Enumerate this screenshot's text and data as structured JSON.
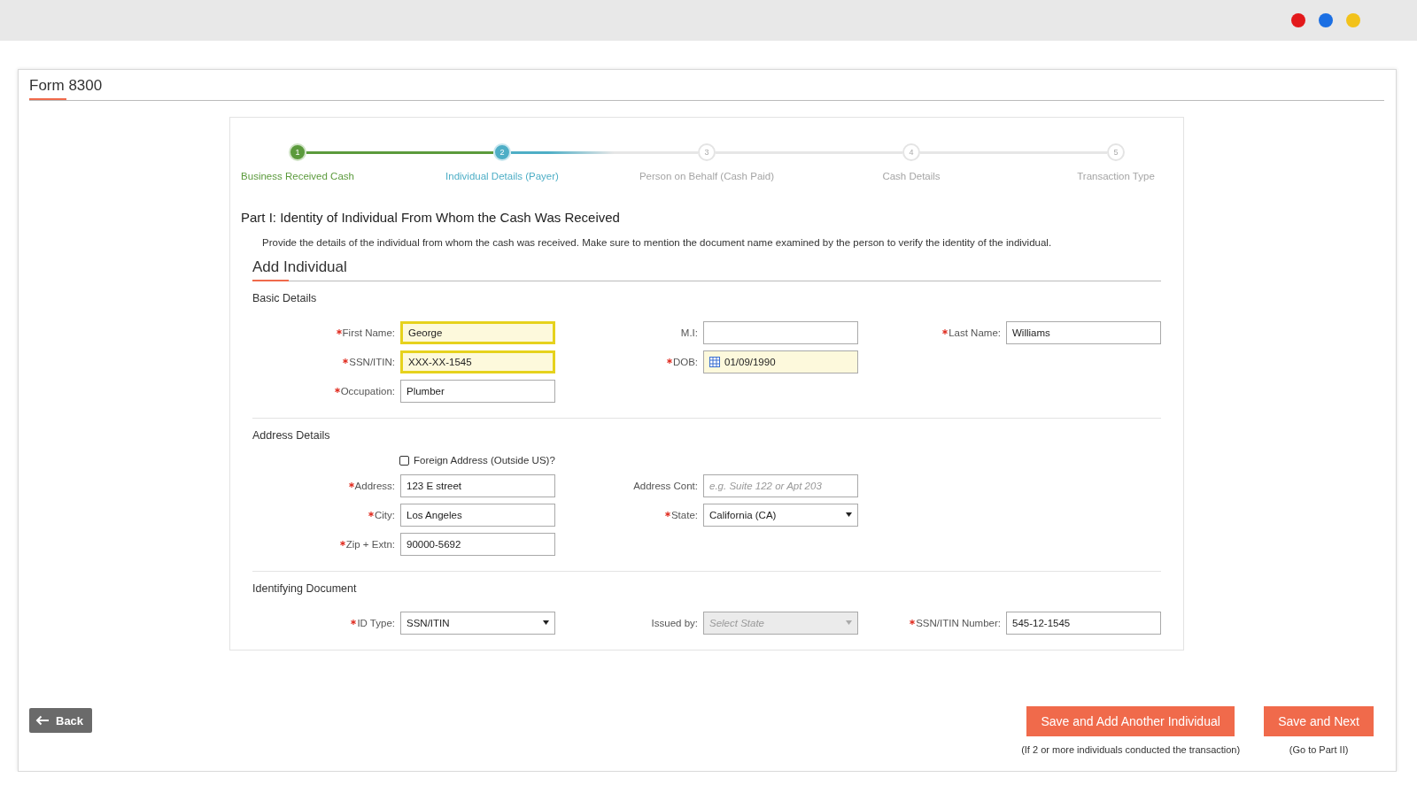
{
  "window_dots": [
    {
      "color": "#e3191b"
    },
    {
      "color": "#1b6fe3"
    },
    {
      "color": "#f2c21b"
    }
  ],
  "title": "Form 8300",
  "steps": [
    {
      "number": "1",
      "label": "Business Received Cash",
      "kind": "done"
    },
    {
      "number": "2",
      "label": "Individual Details (Payer)",
      "kind": "current"
    },
    {
      "number": "3",
      "label": "Person on Behalf (Cash Paid)",
      "kind": "pending"
    },
    {
      "number": "4",
      "label": "Cash Details",
      "kind": "pending"
    },
    {
      "number": "5",
      "label": "Transaction Type",
      "kind": "pending"
    }
  ],
  "part": {
    "heading": "Part I: Identity of Individual From Whom the Cash Was Received",
    "description": "Provide the details of the individual from whom the cash was received. Make sure to mention the document name examined by the person to verify the identity of the individual."
  },
  "section_title": "Add Individual",
  "groups": [
    {
      "title": "Basic Details",
      "rows": [
        [
          {
            "label": "First Name:",
            "required": true,
            "kind": "text",
            "value": "George",
            "highlighted": true,
            "disabled": false
          },
          {
            "label": "M.I:",
            "required": false,
            "kind": "text",
            "highlighted": false,
            "disabled": false
          },
          {
            "label": "Last Name:",
            "required": true,
            "kind": "text",
            "value": "Williams",
            "highlighted": false,
            "disabled": false
          }
        ],
        [
          {
            "label": "SSN/ITIN:",
            "required": true,
            "kind": "text",
            "value": "XXX-XX-1545",
            "highlighted": true,
            "disabled": false
          },
          {
            "label": "DOB:",
            "required": true,
            "kind": "date",
            "value": "01/09/1990",
            "highlighted": false,
            "disabled": false
          }
        ],
        [
          {
            "label": "Occupation:",
            "required": true,
            "kind": "text",
            "value": "Plumber",
            "highlighted": false,
            "disabled": false
          }
        ]
      ]
    },
    {
      "title": "Address Details",
      "checkbox": {
        "label": "Foreign Address (Outside US)?",
        "checked": false
      },
      "rows": [
        [
          {
            "label": "Address:",
            "required": true,
            "kind": "text",
            "value": "123 E street",
            "highlighted": false,
            "disabled": false
          },
          {
            "label": "Address Cont:",
            "required": false,
            "kind": "text",
            "placeholder": "e.g. Suite 122 or Apt 203",
            "highlighted": false,
            "disabled": false
          }
        ],
        [
          {
            "label": "City:",
            "required": true,
            "kind": "text",
            "value": "Los Angeles",
            "highlighted": false,
            "disabled": false
          },
          {
            "label": "State:",
            "required": true,
            "kind": "select",
            "value": "California (CA)",
            "highlighted": false,
            "disabled": false
          }
        ],
        [
          {
            "label": "Zip + Extn:",
            "required": true,
            "kind": "text",
            "value": "90000-5692",
            "highlighted": false,
            "disabled": false
          }
        ]
      ]
    },
    {
      "title": "Identifying Document",
      "rows": [
        [
          {
            "label": "ID Type:",
            "required": true,
            "kind": "select",
            "value": "SSN/ITIN",
            "highlighted": false,
            "disabled": false
          },
          {
            "label": "Issued by:",
            "required": false,
            "kind": "select",
            "placeholder": "Select State",
            "highlighted": false,
            "disabled": true
          },
          {
            "label": "SSN/ITIN Number:",
            "required": true,
            "kind": "text",
            "value": "545-12-1545",
            "highlighted": false,
            "disabled": false
          }
        ]
      ]
    }
  ],
  "back_button": {
    "label": "Back"
  },
  "actions": [
    {
      "label": "Save and Add Another Individual",
      "note": "(If 2 or more individuals conducted the transaction)"
    },
    {
      "label": "Save and Next",
      "note": "(Go to Part II)"
    }
  ]
}
